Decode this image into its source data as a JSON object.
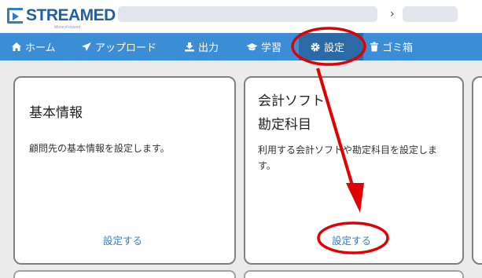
{
  "header": {
    "logo_text": "STREAMED",
    "logo_sub": "MoneyForward",
    "breadcrumb_separator": "›"
  },
  "nav": {
    "items": [
      {
        "label": "ホーム",
        "icon": "home-icon"
      },
      {
        "label": "アップロード",
        "icon": "send-icon"
      },
      {
        "label": "出力",
        "icon": "download-icon"
      },
      {
        "label": "学習",
        "icon": "graduation-cap-icon"
      },
      {
        "label": "設定",
        "icon": "gear-icon",
        "active": true
      },
      {
        "label": "ゴミ箱",
        "icon": "trash-icon"
      }
    ]
  },
  "cards": [
    {
      "title": "基本情報",
      "description": "顧問先の基本情報を設定します。",
      "link": "設定する"
    },
    {
      "title_line1": "会計ソフト",
      "title_line2": "勘定科目",
      "description": "利用する会計ソフトや勘定科目を設定します。",
      "link": "設定する"
    }
  ],
  "colors": {
    "nav_bg": "#3b8ed6",
    "nav_active": "#2a6aa6",
    "link": "#3a7bbd",
    "annotation_red": "#e00000",
    "logo": "#1f5fa8"
  }
}
